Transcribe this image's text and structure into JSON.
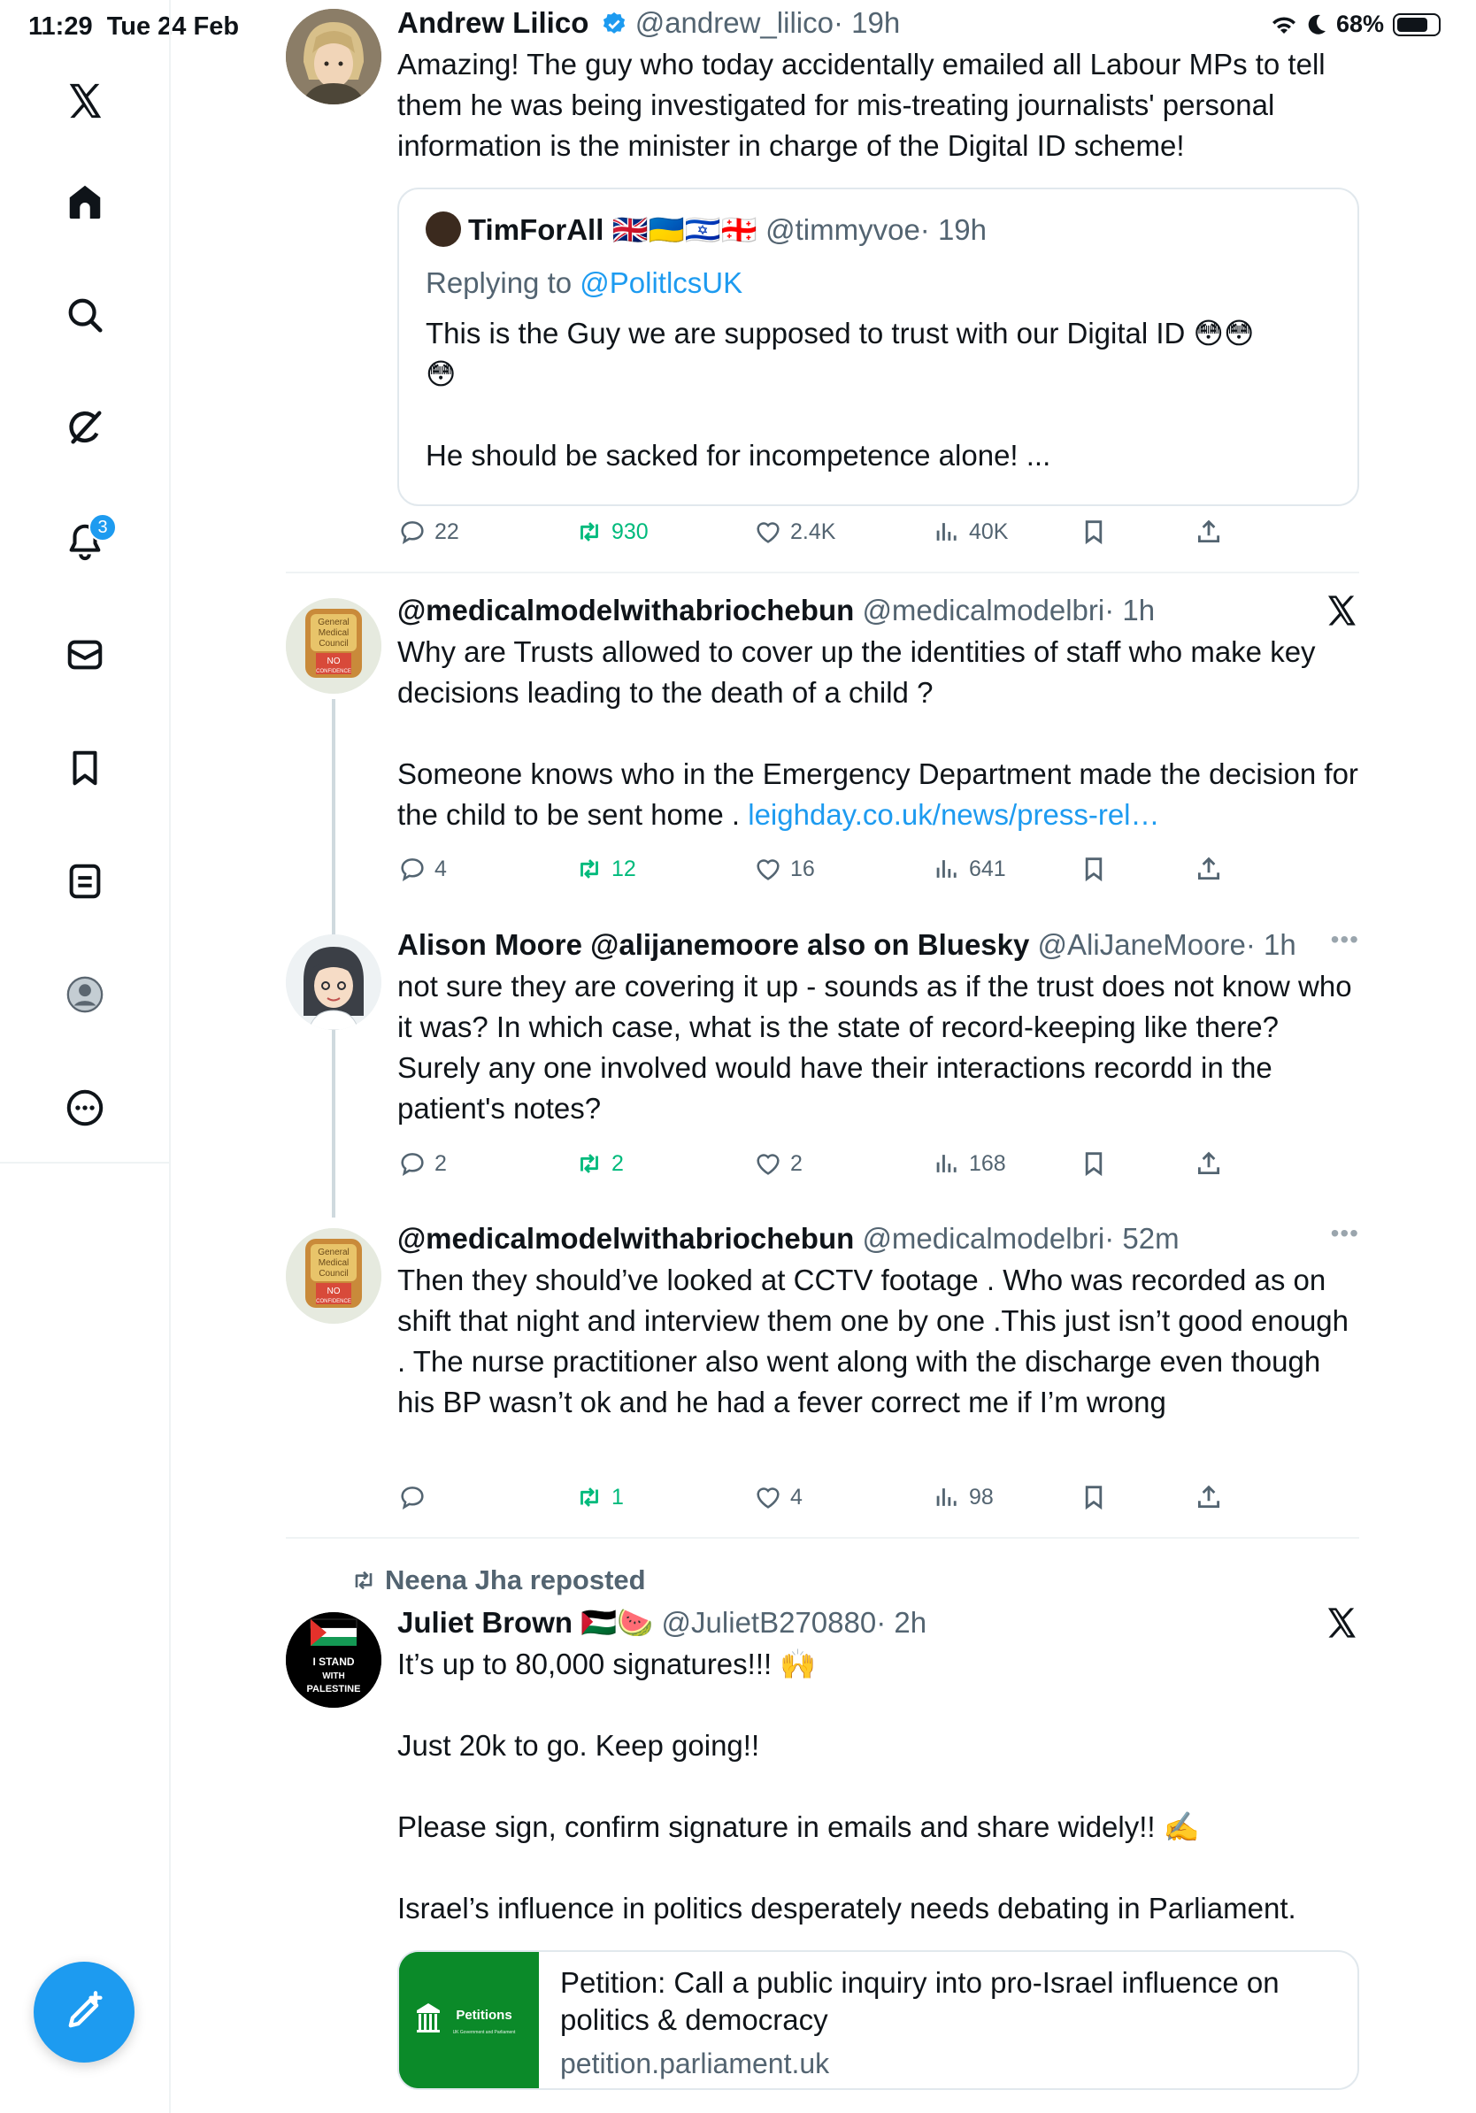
{
  "status_bar": {
    "time": "11:29",
    "date": "Tue 24 Feb",
    "battery": "68%"
  },
  "sidebar": {
    "items": [
      {
        "label": "X",
        "icon": "x-logo-icon"
      },
      {
        "label": "Home",
        "icon": "home-icon"
      },
      {
        "label": "Search",
        "icon": "search-icon"
      },
      {
        "label": "Grok",
        "icon": "grok-icon"
      },
      {
        "label": "Notifications",
        "icon": "bell-icon",
        "badge": "3"
      },
      {
        "label": "Messages",
        "icon": "mail-icon"
      },
      {
        "label": "Bookmarks",
        "icon": "bookmark-icon"
      },
      {
        "label": "Lists",
        "icon": "list-icon"
      },
      {
        "label": "Profile",
        "icon": "profile-icon"
      },
      {
        "label": "More",
        "icon": "more-circle-icon"
      }
    ]
  },
  "tweets": [
    {
      "name": "Andrew Lilico",
      "verified": true,
      "handle": "@andrew_lilico",
      "time": "· 19h",
      "text": "Amazing! The guy who today accidentally emailed all Labour MPs to tell them he was being investigated for mis-treating journalists' personal information is the minister in charge of the Digital ID scheme!",
      "quote": {
        "name": "TimForAll 🇬🇧🇺🇦🇮🇱🇬🇪",
        "handle": "@timmyvoe",
        "time": "· 19h",
        "replying_prefix": "Replying to ",
        "replying_to": "@PolitlcsUK",
        "text": "This is the Guy we are supposed to trust with our Digital ID 😳😳\n😳\n\nHe should be sacked for incompetence alone! ..."
      },
      "stats": {
        "replies": "22",
        "reposts": "930",
        "likes": "2.4K",
        "views": "40K"
      }
    },
    {
      "name": "@medicalmodelwithabriochebun",
      "handle": "@medicalmodelbri",
      "time": "· 1h",
      "text": "Why are Trusts allowed to cover up the identities of staff who make key decisions leading to the death of a child ?\n\nSomeone knows who in the Emergency Department made the decision for the child to be sent home . ",
      "link": "leighday.co.uk/news/press-rel…",
      "stats": {
        "replies": "4",
        "reposts": "12",
        "likes": "16",
        "views": "641"
      }
    },
    {
      "name": "Alison Moore @alijanemoore also on Bluesky",
      "handle": "@AliJaneMoore",
      "time": "· 1h",
      "text": "not sure they are covering it up - sounds as if the trust does not know who it was? In which case, what is the state of record-keeping like there? Surely any one involved would have their interactions recordd in the patient's notes?",
      "stats": {
        "replies": "2",
        "reposts": "2",
        "likes": "2",
        "views": "168"
      }
    },
    {
      "name": "@medicalmodelwithabriochebun",
      "handle": "@medicalmodelbri",
      "time": "· 52m",
      "text": "Then they should’ve looked at CCTV footage . Who was recorded as on shift that night and interview them one by one .This just isn’t good enough . The nurse practitioner also went along with the discharge even though his BP wasn’t ok and he had a fever correct me if I’m wrong",
      "stats": {
        "replies": "",
        "reposts": "1",
        "likes": "4",
        "views": "98"
      }
    },
    {
      "repost_label": "Neena Jha reposted",
      "name": "Juliet Brown 🇵🇸🍉",
      "handle": "@JulietB270880",
      "time": "· 2h",
      "text": "It’s up to 80,000 signatures!!! 🙌\n\nJust 20k to go. Keep going!!\n\nPlease sign, confirm signature in emails and share widely!! ✍️\n\nIsrael’s influence in politics desperately needs debating in Parliament.",
      "avatar_text": [
        "I STAND",
        "WITH",
        "PALESTINE"
      ],
      "card": {
        "thumb_title": "Petitions",
        "thumb_subtitle": "UK Government and Parliament",
        "title": "Petition: Call a public inquiry into pro-Israel influence on politics & democracy",
        "domain": "petition.parliament.uk"
      }
    }
  ],
  "avatar_labels": {
    "council": [
      "General",
      "Medical",
      "Council",
      "NO",
      "CONFIDENCE"
    ]
  },
  "colors": {
    "accent": "#1d9bf0",
    "repost_green": "#00ba7c",
    "secondary_text": "#536471"
  }
}
